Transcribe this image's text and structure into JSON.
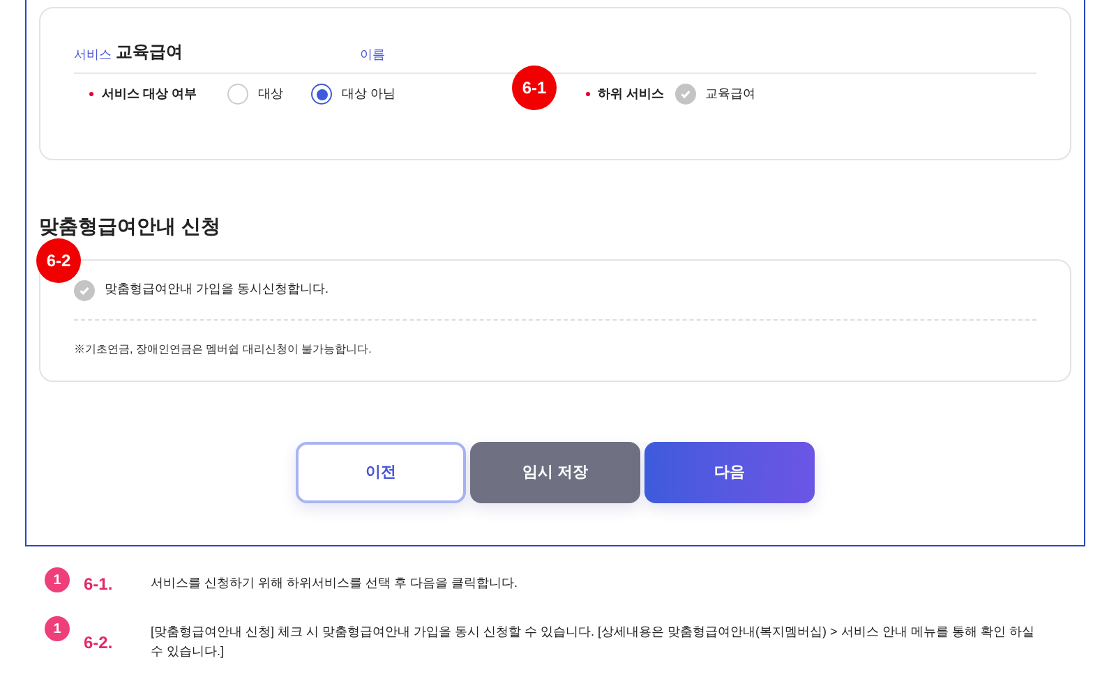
{
  "service_card": {
    "service_label": "서비스",
    "service_name": "교육급여",
    "name_label": "이름",
    "badge": "6-1",
    "target": {
      "label": "서비스 대상 여부",
      "options": [
        {
          "label": "대상",
          "selected": false
        },
        {
          "label": "대상 아님",
          "selected": true
        }
      ]
    },
    "sub_service": {
      "label": "하위 서비스",
      "items": [
        {
          "label": "교육급여",
          "checked": true
        }
      ]
    }
  },
  "guide_section": {
    "title": "맞춤형급여안내 신청",
    "badge": "6-2",
    "consent": {
      "label": "맞춤형급여안내 가입을 동시신청합니다.",
      "checked": true
    },
    "note": "※기초연금, 장애인연금은 멤버쉽 대리신청이 불가능합니다."
  },
  "buttons": [
    {
      "kind": "outline",
      "label": "이전"
    },
    {
      "kind": "gray",
      "label": "임시 저장"
    },
    {
      "kind": "primary",
      "label": "다음"
    }
  ],
  "notes": [
    {
      "marker": "1",
      "number": "6-1.",
      "text": "서비스를 신청하기 위해 하위서비스를 선택 후 다음을 클릭합니다."
    },
    {
      "marker": "1",
      "number": "6-2.",
      "text": "[맞춤형급여안내 신청] 체크 시 맞춤형급여안내 가입을 동시 신청할 수 있습니다. [상세내용은 맞춤형급여안내(복지멤버십) > 서비스 안내 메뉴를 통해 확인 하실 수 있습니다.]"
    }
  ]
}
